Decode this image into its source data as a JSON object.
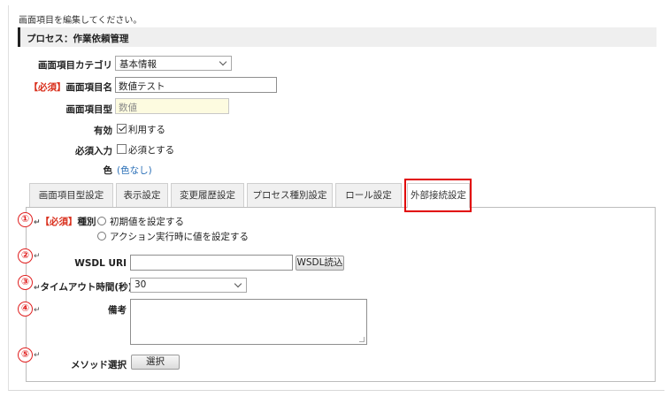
{
  "instruction": "画面項目を編集してください。",
  "process_title": "プロセス：作業依頼管理",
  "form": {
    "category_label": "画面項目カテゴリ",
    "category_value": "基本情報",
    "required_tag": "【必須】",
    "name_label": "画面項目名",
    "name_value": "数値テスト",
    "type_label": "画面項目型",
    "type_value": "数値",
    "enabled_label": "有効",
    "enabled_option": "利用する",
    "enabled_checked": true,
    "required_input_label": "必須入力",
    "required_input_option": "必須とする",
    "required_input_checked": false,
    "color_label": "色",
    "color_value": "(色なし)"
  },
  "tabs": [
    {
      "label": "画面項目型設定"
    },
    {
      "label": "表示設定"
    },
    {
      "label": "変更履歴設定"
    },
    {
      "label": "プロセス種別設定"
    },
    {
      "label": "ロール設定"
    },
    {
      "label": "外部接続設定",
      "active": true
    }
  ],
  "panel": {
    "markers": [
      "①",
      "②",
      "③",
      "④",
      "⑤"
    ],
    "return_glyph": "↵",
    "kind_required": "【必須】",
    "kind_label": "種別",
    "kind_option1": "初期値を設定する",
    "kind_option2": "アクション実行時に値を設定する",
    "wsdl_label": "WSDL URI",
    "wsdl_value": "",
    "wsdl_button": "WSDL読込",
    "timeout_label": "タイムアウト時間(秒)",
    "timeout_value": "30",
    "notes_label": "備考",
    "notes_value": "",
    "method_label": "メソッド選択",
    "method_button": "選択"
  },
  "colors": {
    "required_red": "#d9301d",
    "highlight_red": "#e10000",
    "link_blue": "#2a6fb7",
    "readonly_bg": "#fdfbe0"
  }
}
